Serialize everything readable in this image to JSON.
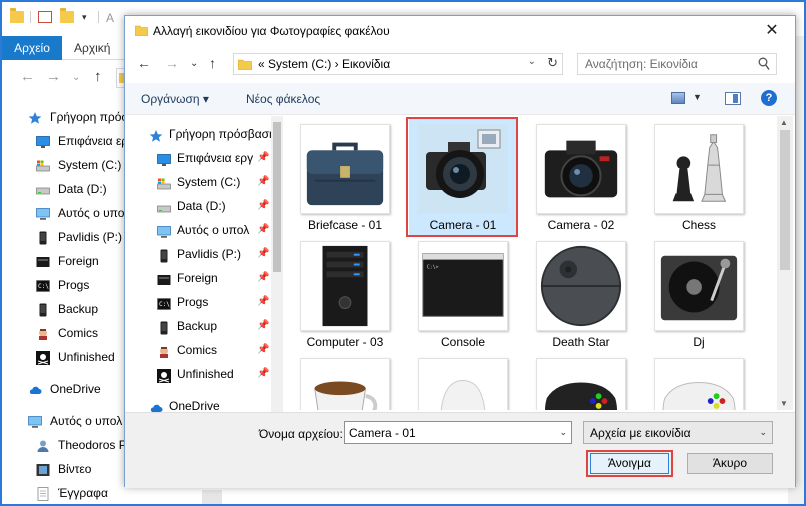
{
  "background_window": {
    "tabs": [
      {
        "label": "Αρχείο"
      },
      {
        "label": "Αρχική"
      }
    ],
    "title_partial": "Α",
    "nav_items": [
      {
        "label": "Γρήγορη πρόσ",
        "icon": "star-icon"
      },
      {
        "label": "Επιφάνεια ερ",
        "icon": "desktop-icon"
      },
      {
        "label": "System (C:)",
        "icon": "drive-c-icon"
      },
      {
        "label": "Data (D:)",
        "icon": "drive-icon"
      },
      {
        "label": "Αυτός ο υπολ",
        "icon": "monitor-icon"
      },
      {
        "label": "Pavlidis (P:)",
        "icon": "phone-icon"
      },
      {
        "label": "Foreign",
        "icon": "folder-dark-icon"
      },
      {
        "label": "Progs",
        "icon": "console-icon"
      },
      {
        "label": "Backup",
        "icon": "phone-icon"
      },
      {
        "label": "Comics",
        "icon": "comics-icon"
      },
      {
        "label": "Unfinished",
        "icon": "pirate-icon"
      },
      {
        "label": "OneDrive",
        "icon": "cloud-icon"
      },
      {
        "label": "Αυτός ο υπολ",
        "icon": "monitor-icon"
      },
      {
        "label": "Theodoros P",
        "icon": "user-icon"
      },
      {
        "label": "Βίντεο",
        "icon": "video-icon"
      },
      {
        "label": "Έγγραφα",
        "icon": "documents-icon"
      }
    ]
  },
  "dialog": {
    "title": "Αλλαγή εικονιδίου για Φωτογραφίες φακέλου",
    "address": {
      "path": "«  System (C:)  ›  Εικονίδια"
    },
    "search": {
      "placeholder": "Αναζήτηση: Εικονίδια"
    },
    "toolbar": {
      "organize_label": "Οργάνωση ▾",
      "new_folder_label": "Νέος φάκελος",
      "help_label": "?"
    },
    "nav_items": [
      {
        "label": "Γρήγορη πρόσβαση",
        "icon": "star-icon"
      },
      {
        "label": "Επιφάνεια εργ",
        "icon": "desktop-icon"
      },
      {
        "label": "System (C:)",
        "icon": "drive-c-icon"
      },
      {
        "label": "Data (D:)",
        "icon": "drive-icon"
      },
      {
        "label": "Αυτός ο υπολ",
        "icon": "monitor-icon"
      },
      {
        "label": "Pavlidis (P:)",
        "icon": "phone-icon"
      },
      {
        "label": "Foreign",
        "icon": "folder-dark-icon"
      },
      {
        "label": "Progs",
        "icon": "console-icon"
      },
      {
        "label": "Backup",
        "icon": "phone-icon"
      },
      {
        "label": "Comics",
        "icon": "comics-icon"
      },
      {
        "label": "Unfinished",
        "icon": "pirate-icon"
      },
      {
        "label": "OneDrive",
        "icon": "cloud-icon"
      }
    ],
    "files": [
      {
        "label": "Briefcase - 01",
        "thumb": "briefcase"
      },
      {
        "label": "Camera - 01",
        "thumb": "camera-pro",
        "selected": true
      },
      {
        "label": "Camera - 02",
        "thumb": "camera-dslr"
      },
      {
        "label": "Chess",
        "thumb": "chess"
      },
      {
        "label": "Computer - 03",
        "thumb": "computer-tower"
      },
      {
        "label": "Console",
        "thumb": "console-window"
      },
      {
        "label": "Death Star",
        "thumb": "death-star"
      },
      {
        "label": "Dj",
        "thumb": "turntable"
      },
      {
        "label": "",
        "thumb": "coffee-cup"
      },
      {
        "label": "",
        "thumb": "white-hat"
      },
      {
        "label": "",
        "thumb": "gamepad-black"
      },
      {
        "label": "",
        "thumb": "gamepad-white"
      }
    ],
    "filename": {
      "label": "Όνομα αρχείου:",
      "value": "Camera - 01"
    },
    "filetype": {
      "value": "Αρχεία με εικονίδια"
    },
    "buttons": {
      "open": "Άνοιγμα",
      "cancel": "Άκυρο"
    }
  },
  "colors": {
    "accent": "#1979ca",
    "selection": "#cce8ff",
    "highlight_box": "#e04343"
  }
}
